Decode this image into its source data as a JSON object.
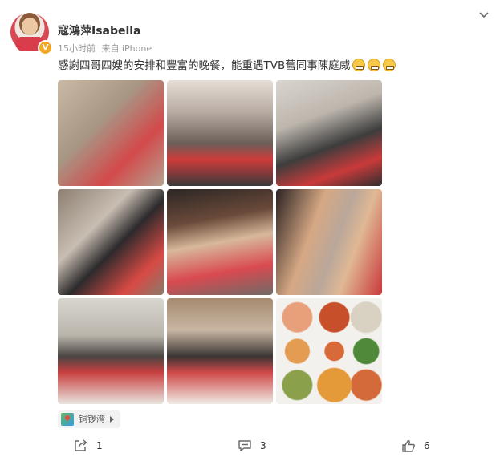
{
  "post": {
    "username": "寇鴻萍Isabella",
    "time": "15小时前",
    "source": "来自 iPhone",
    "text": "感謝四哥四嫂的安排和豐富的晚餐，能重遇TVB舊同事陳庭威",
    "emojis": [
      "grin-emoji",
      "grin-emoji",
      "grin-emoji"
    ],
    "verified_badge": "V",
    "location": "铜锣湾"
  },
  "actions": {
    "share_count": "1",
    "comment_count": "3",
    "like_count": "6"
  },
  "colors": {
    "badge": "#f5a623",
    "text": "#333333",
    "meta": "#999999"
  }
}
